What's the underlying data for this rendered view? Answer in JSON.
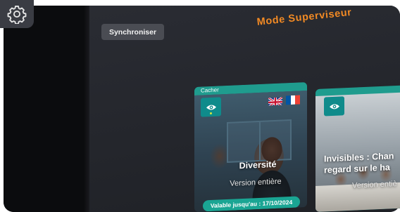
{
  "header": {
    "title": "Mode Superviseur",
    "sync_label": "Synchroniser"
  },
  "settings": {
    "icon": "gear-icon"
  },
  "cards": [
    {
      "cap_label": "Cacher",
      "title": "Diversité",
      "subtitle": "Version entière",
      "validity": "Valable jusqu'au : 17/10/2024",
      "visibility_icon": "eye-icon",
      "languages": [
        "uk-flag-icon",
        "fr-flag-icon"
      ]
    },
    {
      "title_line1": "Invisibles : Chan",
      "title_line2": "regard sur le ha",
      "subtitle": "Version entiè",
      "visibility_icon": "eye-icon"
    }
  ],
  "colors": {
    "accent_orange": "#f28a24",
    "teal": "#1f9c8e",
    "panel_bg": "#25272d"
  }
}
